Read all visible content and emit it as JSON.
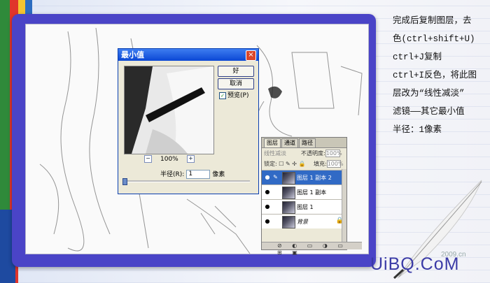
{
  "instructions": {
    "lines": [
      "完成后复制图层，去",
      "色(ctrl+shift+U)",
      "ctrl+J复制",
      "ctrl+I反色，将此图",
      "层改为“线性减淡”",
      "滤镜——其它最小值",
      "半径：1像素"
    ]
  },
  "dialog": {
    "title": "最小值",
    "ok_label": "好",
    "cancel_label": "取消",
    "preview_label": "预览(P)",
    "preview_checked": true,
    "zoom_value": "100%",
    "zoom_out": "−",
    "zoom_in": "+",
    "radius_label": "半径(R):",
    "radius_value": "1",
    "radius_unit": "像素",
    "close_label": "×"
  },
  "layers_panel": {
    "tabs": [
      "图层",
      "通道",
      "路径"
    ],
    "blend_mode": "线性减淡",
    "opacity_label": "不透明度:",
    "opacity_value": "100%",
    "lock_label": "锁定:",
    "fill_label": "填充:",
    "fill_value": "100%",
    "layers": [
      {
        "name": "图层 1 副本 2",
        "selected": true
      },
      {
        "name": "图层 1 副本",
        "selected": false
      },
      {
        "name": "图层 1",
        "selected": false
      },
      {
        "name": "背景",
        "selected": false
      }
    ],
    "bottom_icons": "⊘ ◐ ▭ ◑ ▭ ⊞ ▣"
  },
  "branding": {
    "logo": "UiBQ.CoM",
    "watermark": "2009.cn"
  },
  "colors": {
    "frame": "#4a44c7",
    "selection": "#316ac5",
    "title_bar": "#0a47d5"
  }
}
